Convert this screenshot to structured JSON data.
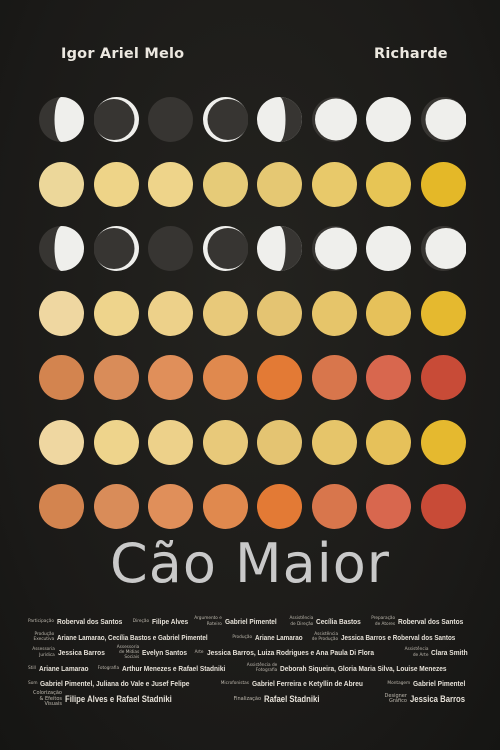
{
  "actors": {
    "left": "Igor Ariel Melo",
    "right": "Richarde"
  },
  "title": "Cão Maior",
  "moon_colors": {
    "light": "#efefec",
    "dark": "#373532"
  },
  "moon_rows": [
    [
      "waning-gibbous",
      "waning-crescent",
      "new",
      "waxing-crescent",
      "first-quarter-left",
      "waxing-gibbous",
      "full",
      "full-offset"
    ],
    [
      "waning-gibbous",
      "waning-crescent",
      "new",
      "waxing-crescent",
      "first-quarter-left",
      "waxing-gibbous",
      "full",
      "full-offset"
    ]
  ],
  "color_rows": [
    [
      "#ecd79a",
      "#eed488",
      "#eed48a",
      "#e6cb78",
      "#e5c873",
      "#e8c96a",
      "#e7c555",
      "#e4b828"
    ],
    [
      "#efd7a1",
      "#eed48c",
      "#edd18a",
      "#e8c97a",
      "#e4c472",
      "#e6c56a",
      "#e6c15a",
      "#e5b92f"
    ],
    [
      "#d3844f",
      "#d98c59",
      "#e08f5a",
      "#e0894e",
      "#e37a35",
      "#d8764c",
      "#d8674e",
      "#c84b37"
    ],
    [
      "#efd7a1",
      "#eed48c",
      "#edd18a",
      "#e8c97a",
      "#e4c472",
      "#e6c56a",
      "#e6c15a",
      "#e5b92f"
    ],
    [
      "#d3844f",
      "#d98c59",
      "#e08f5a",
      "#e0894e",
      "#e37a35",
      "#d8764c",
      "#d8674e",
      "#c84b37"
    ]
  ],
  "credits": [
    [
      {
        "label": "Participação",
        "names": "Roberval dos Santos"
      },
      {
        "label": "Direção",
        "names": "Filipe Alves"
      },
      {
        "label": "Argumento e Roteiro",
        "names": "Gabriel Pimentel"
      },
      {
        "label": "Assistência de Direção",
        "names": "Cecília Bastos"
      },
      {
        "label": "Preparação de Atores",
        "names": "Roberval dos Santos"
      }
    ],
    [
      {
        "label": "Produção Executiva",
        "names": "Ariane Lamarao, Cecília Bastos e Gabriel Pimentel"
      },
      {
        "label": "Produção",
        "names": "Ariane Lamarao"
      },
      {
        "label": "Assistência de Produção",
        "names": "Jessica Barros e Roberval dos Santos"
      }
    ],
    [
      {
        "label": "Assessoria Jurídica",
        "names": "Jessica Barros"
      },
      {
        "label": "Assessoria de Mídias Sociais",
        "names": "Evelyn Santos"
      },
      {
        "label": "Arte",
        "names": "Jessica Barros, Luiza Rodrigues e Ana Paula Di Flora"
      },
      {
        "label": "Assistência de Arte",
        "names": "Clara Smith"
      }
    ],
    [
      {
        "label": "Still",
        "names": "Ariane Lamarao"
      },
      {
        "label": "Fotografia",
        "names": "Arthur Menezes e Rafael Stadniki"
      },
      {
        "label": "Assistência de Fotografia",
        "names": "Deborah Siqueira, Gloria Maria Silva, Louise Menezes"
      }
    ],
    [
      {
        "label": "Som",
        "names": "Gabriel Pimentel, Juliana do Vale e Jusef Felipe"
      },
      {
        "label": "Microfonistas",
        "names": "Gabriel Ferreira e Ketyllin de Abreu"
      },
      {
        "label": "Montagem",
        "names": "Gabriel Pimentel"
      }
    ],
    [
      {
        "label": "Colorização & Efeitos Visuais",
        "names": "Filipe Alves e Rafael Stadniki"
      },
      {
        "label": "Finalização",
        "names": "Rafael Stadniki"
      },
      {
        "label": "Designer Gráfico",
        "names": "Jessica Barros"
      }
    ]
  ]
}
